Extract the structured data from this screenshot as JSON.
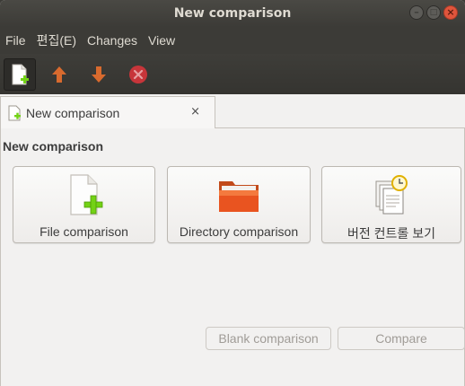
{
  "window": {
    "title": "New comparison",
    "controls": [
      {
        "name": "minimize",
        "glyph": "–"
      },
      {
        "name": "maximize",
        "glyph": "□"
      },
      {
        "name": "close",
        "glyph": "×"
      }
    ]
  },
  "menubar": {
    "items": [
      "File",
      "편집(E)",
      "Changes",
      "View"
    ]
  },
  "toolbar": {
    "buttons": [
      {
        "name": "new-comparison",
        "icon": "new-document-icon"
      },
      {
        "name": "previous-change",
        "icon": "arrow-up-icon"
      },
      {
        "name": "next-change",
        "icon": "arrow-down-icon"
      },
      {
        "name": "stop",
        "icon": "stop-icon"
      }
    ]
  },
  "tab": {
    "label": "New comparison",
    "close": "×"
  },
  "main": {
    "section_title": "New comparison",
    "cards": {
      "file": {
        "label": "File comparison",
        "icon": "file-add-icon"
      },
      "directory": {
        "label": "Directory comparison",
        "icon": "folder-icon"
      },
      "version_control": {
        "label": "버전 컨트롤 보기",
        "icon": "version-control-icon"
      }
    },
    "blank_button": "Blank comparison",
    "compare_button": "Compare"
  },
  "colors": {
    "chrome_dark": "#3c3b37",
    "surface": "#f2f1f0",
    "accent_orange": "#e95420",
    "add_green": "#73d216",
    "disabled_text": "#a09c97"
  }
}
